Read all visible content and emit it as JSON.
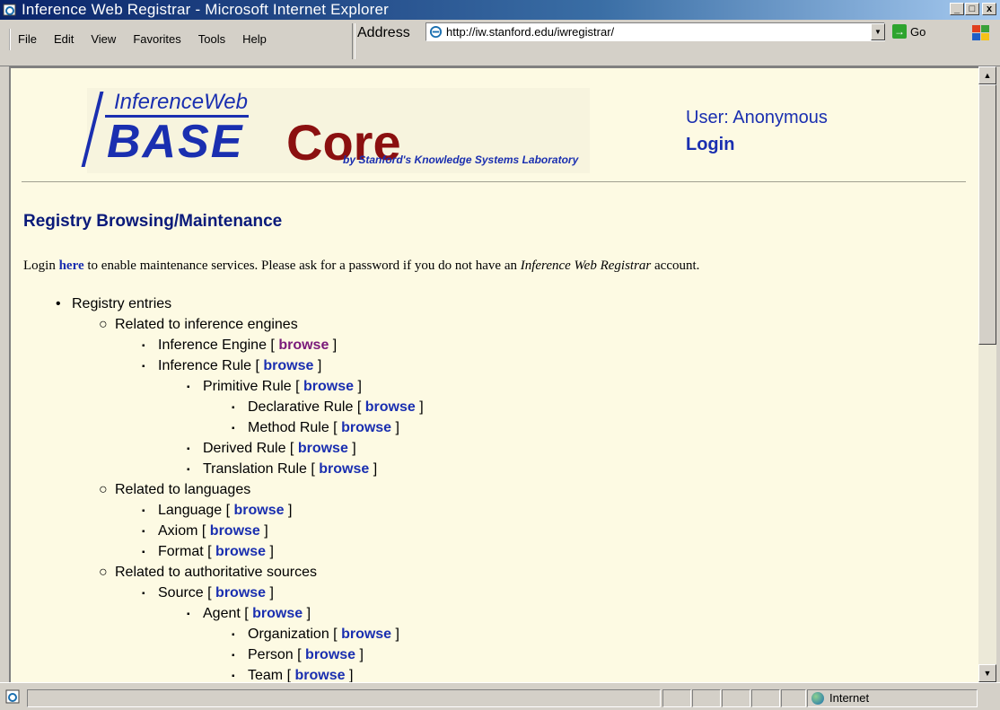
{
  "window": {
    "title": "Inference Web Registrar - Microsoft Internet Explorer",
    "controls": [
      "minimize",
      "maximize",
      "close"
    ]
  },
  "menu": {
    "items": [
      {
        "label": "File"
      },
      {
        "label": "Edit"
      },
      {
        "label": "View"
      },
      {
        "label": "Favorites"
      },
      {
        "label": "Tools"
      },
      {
        "label": "Help"
      }
    ]
  },
  "address": {
    "label": "Address",
    "url": "http://iw.stanford.edu/iwregistrar/",
    "go_label": "Go"
  },
  "banner": {
    "logo_top": "InferenceWeb",
    "logo_base": "BASE",
    "logo_core": "Core",
    "logo_by": "by Stanford's Knowledge Systems Laboratory",
    "user": "User: Anonymous",
    "login": "Login"
  },
  "page": {
    "heading": "Registry Browsing/Maintenance",
    "intro_pre": "Login",
    "intro_link": "here",
    "intro_mid": "to enable maintenance services. Please ask for a password if you do not have an",
    "intro_italic": "Inference Web Registrar",
    "intro_post": "account."
  },
  "tree": [
    {
      "label": "Registry entries",
      "level": 0
    },
    {
      "label": "Related to inference engines",
      "level": 1
    },
    {
      "label": "Inference Engine [",
      "level": 2,
      "link": "browse",
      "visited": true,
      "close": "]"
    },
    {
      "label": "Inference Rule [",
      "level": 2,
      "link": "browse",
      "close": "]"
    },
    {
      "label": "Primitive Rule [",
      "level": 3,
      "link": "browse",
      "close": "]"
    },
    {
      "label": "Declarative Rule [",
      "level": 4,
      "link": "browse",
      "close": "]"
    },
    {
      "label": "Method Rule [",
      "level": 4,
      "link": "browse",
      "close": "]"
    },
    {
      "label": "Derived Rule [",
      "level": 3,
      "link": "browse",
      "close": "]"
    },
    {
      "label": "Translation Rule [",
      "level": 3,
      "link": "browse",
      "close": "]"
    },
    {
      "label": "Related to languages",
      "level": 1
    },
    {
      "label": "Language [",
      "level": 2,
      "link": "browse",
      "close": "]"
    },
    {
      "label": "Axiom [",
      "level": 2,
      "link": "browse",
      "close": "]"
    },
    {
      "label": "Format [",
      "level": 2,
      "link": "browse",
      "close": "]"
    },
    {
      "label": "Related to authoritative sources",
      "level": 1
    },
    {
      "label": "Source [",
      "level": 2,
      "link": "browse",
      "close": "]"
    },
    {
      "label": "Agent [",
      "level": 3,
      "link": "browse",
      "close": "]"
    },
    {
      "label": "Organization [",
      "level": 4,
      "link": "browse",
      "close": "]"
    },
    {
      "label": "Person [",
      "level": 4,
      "link": "browse",
      "close": "]"
    },
    {
      "label": "Team [",
      "level": 4,
      "link": "browse",
      "close": "]"
    }
  ],
  "status": {
    "zone": "Internet"
  },
  "colors": {
    "page_bg": "#fdfae3",
    "link": "#1a2fb0",
    "visited": "#7a1a7a",
    "heading": "#0a1a7a",
    "core": "#8b1010"
  }
}
